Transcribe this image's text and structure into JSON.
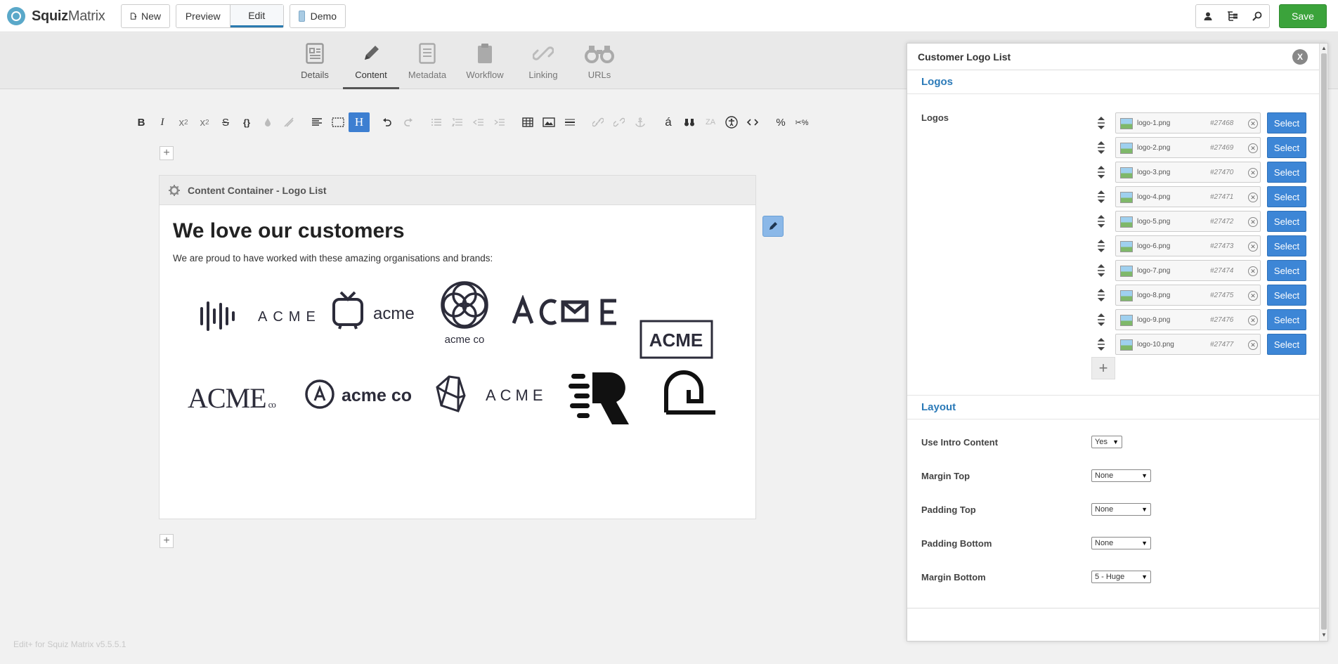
{
  "app": {
    "brand_bold": "Squiz",
    "brand_rest": "Matrix"
  },
  "topbar": {
    "new_label": "New",
    "preview_label": "Preview",
    "edit_label": "Edit",
    "demo_label": "Demo",
    "save_label": "Save"
  },
  "tabs": [
    {
      "label": "Details",
      "icon": "document-icon"
    },
    {
      "label": "Content",
      "icon": "pencil-icon"
    },
    {
      "label": "Metadata",
      "icon": "file-icon"
    },
    {
      "label": "Workflow",
      "icon": "clipboard-icon"
    },
    {
      "label": "Linking",
      "icon": "link-icon"
    },
    {
      "label": "URLs",
      "icon": "binoculars-icon"
    }
  ],
  "active_tab": "Content",
  "container": {
    "header": "Content Container - Logo List",
    "title": "We love our customers",
    "intro": "We are proud to have worked with these amazing organisations and brands:"
  },
  "logos_display": {
    "row1": [
      "ACME",
      "acme",
      "acme co",
      "ACME",
      "ACME"
    ],
    "row2": [
      "ACME co",
      "acme co",
      "ACME"
    ]
  },
  "footer_note": "Edit+ for Squiz Matrix v5.5.5.1",
  "panel": {
    "title": "Customer Logo List",
    "close_label": "X",
    "logos_section": "Logos",
    "logos_label": "Logos",
    "select_label": "Select",
    "logos": [
      {
        "file": "logo-1.png",
        "id": "#27468"
      },
      {
        "file": "logo-2.png",
        "id": "#27469"
      },
      {
        "file": "logo-3.png",
        "id": "#27470"
      },
      {
        "file": "logo-4.png",
        "id": "#27471"
      },
      {
        "file": "logo-5.png",
        "id": "#27472"
      },
      {
        "file": "logo-6.png",
        "id": "#27473"
      },
      {
        "file": "logo-7.png",
        "id": "#27474"
      },
      {
        "file": "logo-8.png",
        "id": "#27475"
      },
      {
        "file": "logo-9.png",
        "id": "#27476"
      },
      {
        "file": "logo-10.png",
        "id": "#27477"
      }
    ],
    "layout_section": "Layout",
    "fields": [
      {
        "label": "Use Intro Content",
        "value": "Yes"
      },
      {
        "label": "Margin Top",
        "value": "None"
      },
      {
        "label": "Padding Top",
        "value": "None"
      },
      {
        "label": "Padding Bottom",
        "value": "None"
      },
      {
        "label": "Margin Bottom",
        "value": "5 - Huge"
      }
    ]
  },
  "colors": {
    "accent": "#2b7ab8",
    "save": "#3ba33b",
    "select": "#3d86d6",
    "logo_ink": "#2c2c3a"
  }
}
